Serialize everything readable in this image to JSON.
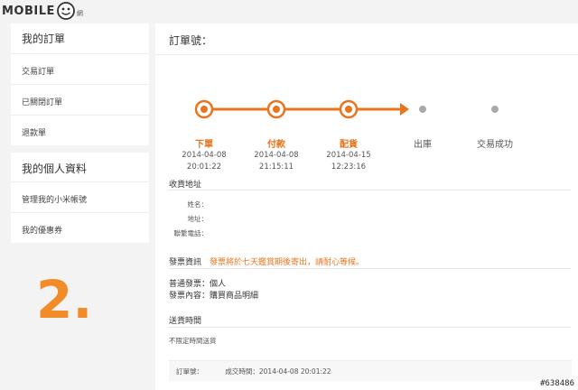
{
  "logo": {
    "text": "MOBILE",
    "sub": "01",
    "extra": "網"
  },
  "sidebar": {
    "orders_title": "我的訂單",
    "orders_items": [
      "交易訂單",
      "已關閉訂單",
      "退款單"
    ],
    "profile_title": "我的個人資料",
    "profile_items": [
      "管理我的小米帳號",
      "我的優惠券"
    ]
  },
  "big_number": "2.",
  "main": {
    "header": "訂單號：",
    "steps": [
      {
        "label": "下單",
        "date": "2014-04-08",
        "time": "20:01:22",
        "done": true
      },
      {
        "label": "付款",
        "date": "2014-04-08",
        "time": "21:15:11",
        "done": true
      },
      {
        "label": "配貨",
        "date": "2014-04-15",
        "time": "12:23:16",
        "done": true
      },
      {
        "label": "出庫",
        "date": "",
        "time": "",
        "done": false
      },
      {
        "label": "交易成功",
        "date": "",
        "time": "",
        "done": false
      }
    ],
    "address": {
      "title": "收貨地址",
      "name_label": "姓名：",
      "addr_label": "地址：",
      "phone_label": "聯繫電話："
    },
    "invoice": {
      "title": "發票資訊",
      "note": "發票將於七天鑑賞期後寄出，請耐心等候。",
      "type": "普通發票：個人",
      "content": "發票內容：購買商品明細"
    },
    "delivery": {
      "title": "送貨時間",
      "value": "不限定時間送貨"
    },
    "footer": {
      "order_no": "訂單號：",
      "deal_time": "成交時間：2014-04-08 20:01:22"
    }
  },
  "badge": "#638486",
  "colors": {
    "accent": "#e8741e",
    "inactive": "#aaaaaa"
  }
}
